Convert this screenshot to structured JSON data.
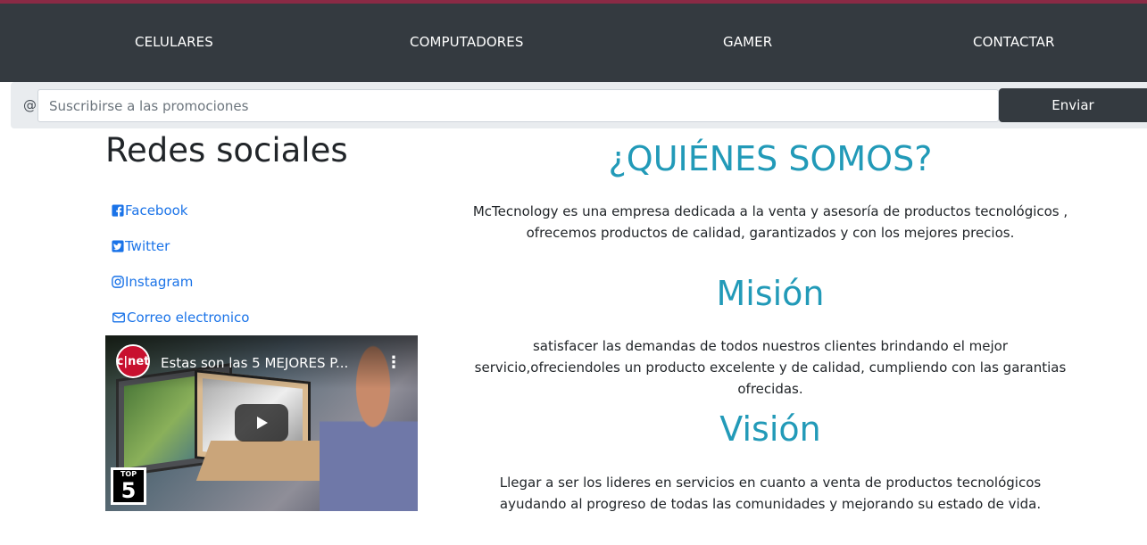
{
  "nav": {
    "items": [
      "CELULARES",
      "COMPUTADORES",
      "GAMER",
      "CONTACTAR"
    ]
  },
  "subscribe": {
    "prefix": "@",
    "placeholder": "Suscribirse a las promociones",
    "button_label": "Enviar"
  },
  "social": {
    "title": "Redes sociales",
    "links": [
      {
        "label": "Facebook",
        "icon": "facebook-icon"
      },
      {
        "label": "Twitter",
        "icon": "twitter-icon"
      },
      {
        "label": "Instagram",
        "icon": "instagram-icon"
      },
      {
        "label": "Correo electronico",
        "icon": "envelope-icon"
      }
    ]
  },
  "video": {
    "title": "Estas son las 5 MEJORES P...",
    "channel": "c|net",
    "badge_small": "TOP",
    "badge_big": "5"
  },
  "about": {
    "title": "¿QUIÉNES SOMOS?",
    "text": "McTecnology es una empresa dedicada a la venta y asesoría de productos tecnológicos , ofrecemos productos de calidad, garantizados y con los mejores precios."
  },
  "mission": {
    "title": "Misión",
    "text": "satisfacer las demandas de todos nuestros clientes brindando el mejor servicio,ofreciendoles un producto excelente y de calidad, cumpliendo con las garantias ofrecidas."
  },
  "vision": {
    "title": "Visión",
    "text": "Llegar a ser los lideres en servicios en cuanto a venta de productos tecnológicos ayudando al progreso de todas las comunidades y mejorando su estado de vida."
  },
  "colors": {
    "navbar": "#343a40",
    "accent_heading": "#229ab8",
    "link": "#1a73e8"
  }
}
